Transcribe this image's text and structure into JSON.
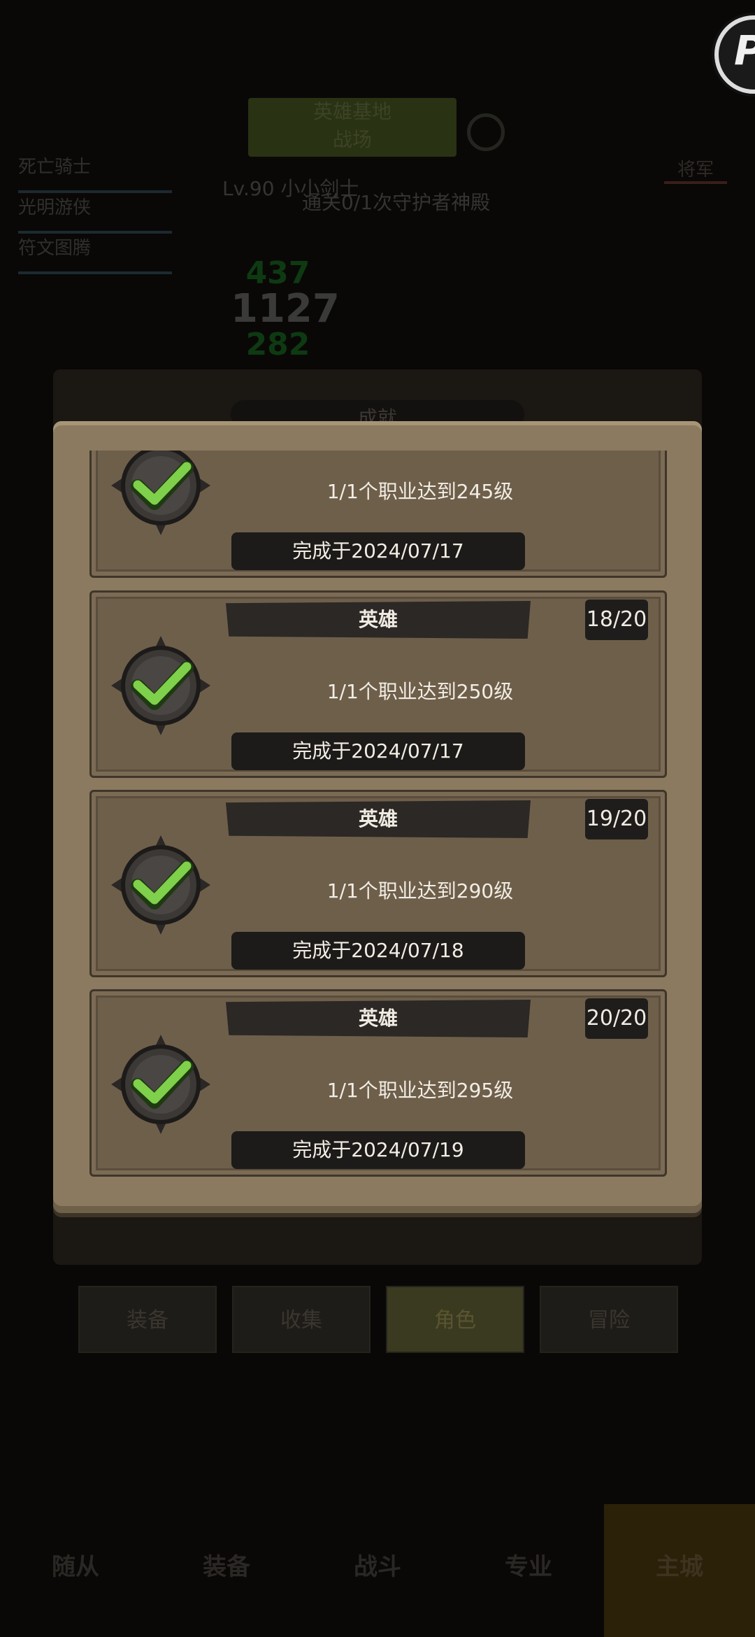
{
  "background": {
    "top_button_line1": "英雄基地",
    "top_button_line2": "战场",
    "left_list": [
      "死亡骑士",
      "光明游侠",
      "符文图腾"
    ],
    "right_tag": "将军",
    "level_text": "Lv.90 小小剑士",
    "quest_text": "通关0/1次守护者神殿",
    "stat_top": "437",
    "stat_mid": "1127",
    "stat_bottom": "282",
    "panel_title": "成就",
    "tabs": [
      "装备",
      "收集",
      "角色",
      "冒险"
    ],
    "bottom_nav": [
      "随从",
      "装备",
      "战斗",
      "专业",
      "主城"
    ]
  },
  "achievements": [
    {
      "tag": "",
      "count": "",
      "desc": "1/1个职业达到245级",
      "date": "完成于2024/07/17",
      "completed": true
    },
    {
      "tag": "英雄",
      "count": "18/20",
      "desc": "1/1个职业达到250级",
      "date": "完成于2024/07/17",
      "completed": true
    },
    {
      "tag": "英雄",
      "count": "19/20",
      "desc": "1/1个职业达到290级",
      "date": "完成于2024/07/18",
      "completed": true
    },
    {
      "tag": "英雄",
      "count": "20/20",
      "desc": "1/1个职业达到295级",
      "date": "完成于2024/07/19",
      "completed": true
    }
  ],
  "colors": {
    "panel": "#8b7a5f",
    "card": "#6e5f4b",
    "check": "#7fd04a",
    "badge": "#3b3836"
  },
  "icons": {
    "badge": "completed-check-badge-icon",
    "corner": "corner-app-icon"
  }
}
